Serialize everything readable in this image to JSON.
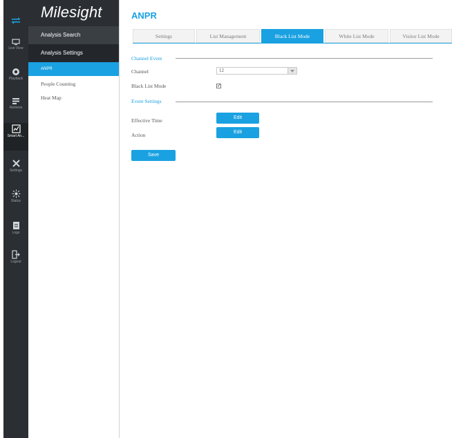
{
  "app": {
    "logo": "Milesight"
  },
  "rail": [
    {
      "icon": "live-view-icon",
      "label": "Live View"
    },
    {
      "icon": "playback-icon",
      "label": "Playback"
    },
    {
      "icon": "retrieve-icon",
      "label": "Retrieve"
    },
    {
      "icon": "smart-analysis-icon",
      "label": "Smart An..."
    },
    {
      "icon": "settings-icon",
      "label": "Settings"
    },
    {
      "icon": "status-icon",
      "label": "Status"
    },
    {
      "icon": "logs-icon",
      "label": "Logs"
    },
    {
      "icon": "logout-icon",
      "label": "Logout"
    }
  ],
  "sidebar": {
    "analysis_search": "Analysis Search",
    "analysis_settings": "Analysis Settings",
    "items": [
      "ANPR",
      "People Counting",
      "Heat Map"
    ]
  },
  "page": {
    "title": "ANPR"
  },
  "tabs": [
    "Settings",
    "List Management",
    "Black List Mode",
    "White List Mode",
    "Visitor List Mode"
  ],
  "active_tab": "Black List Mode",
  "form": {
    "channel_event": "Channel Event",
    "channel_label": "Channel",
    "channel_value": "12",
    "black_list_mode_label": "Black List Mode",
    "black_list_mode_checked": true,
    "event_settings": "Event Settings",
    "effective_time_label": "Effective Time",
    "action_label": "Action",
    "edit_label": "Edit",
    "save_label": "Save"
  },
  "colors": {
    "accent": "#1aa1e1",
    "rail_bg": "#2b2f33",
    "menu_dark": "#23272b"
  }
}
